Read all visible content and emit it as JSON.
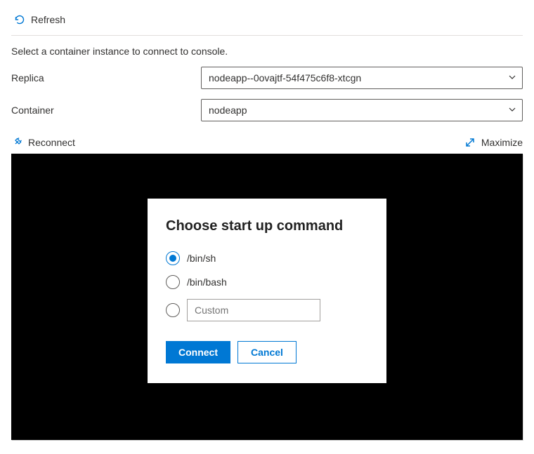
{
  "toolbar": {
    "refresh_label": "Refresh"
  },
  "help_text": "Select a container instance to connect to console.",
  "form": {
    "replica_label": "Replica",
    "replica_value": "nodeapp--0ovajtf-54f475c6f8-xtcgn",
    "container_label": "Container",
    "container_value": "nodeapp"
  },
  "terminal_bar": {
    "reconnect_label": "Reconnect",
    "maximize_label": "Maximize"
  },
  "modal": {
    "title": "Choose start up command",
    "options": {
      "binsh": "/bin/sh",
      "binbash": "/bin/bash",
      "custom_placeholder": "Custom"
    },
    "connect_label": "Connect",
    "cancel_label": "Cancel"
  }
}
